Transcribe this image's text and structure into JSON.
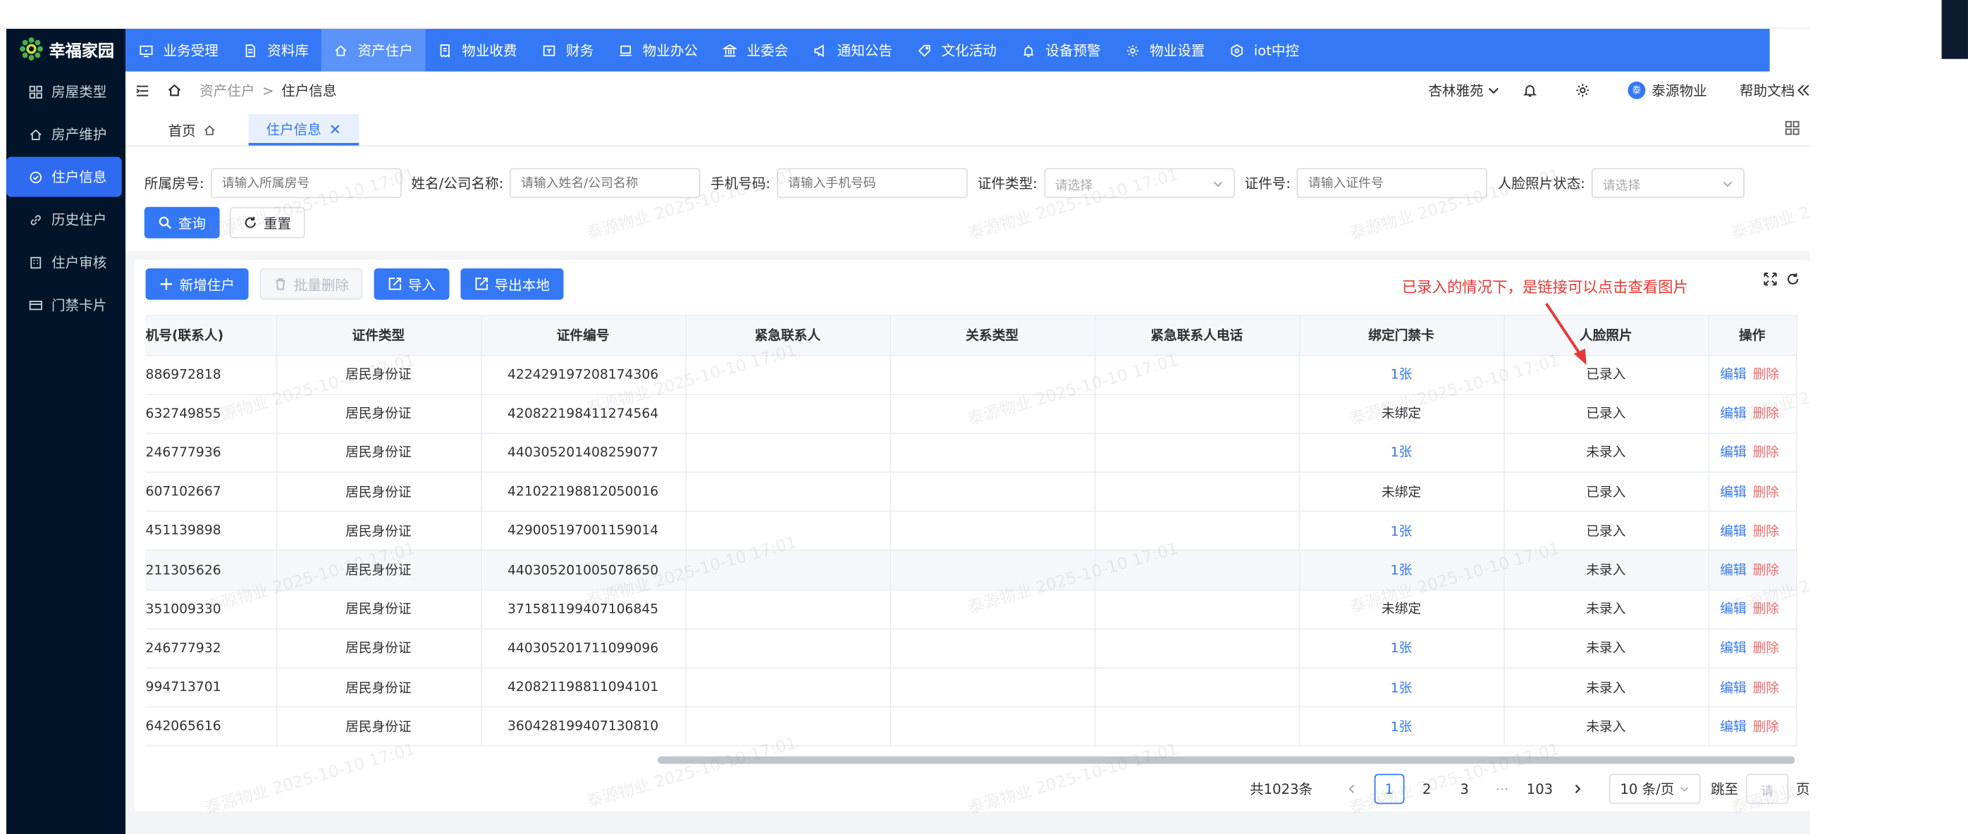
{
  "app": {
    "logo_text": "幸福家园"
  },
  "sidebar": {
    "items": [
      {
        "label": "房屋类型",
        "icon": "grid-icon"
      },
      {
        "label": "房产维护",
        "icon": "home-icon"
      },
      {
        "label": "住户信息",
        "icon": "check-circle-icon",
        "active": true
      },
      {
        "label": "历史住户",
        "icon": "link-icon"
      },
      {
        "label": "住户审核",
        "icon": "building-icon"
      },
      {
        "label": "门禁卡片",
        "icon": "card-icon"
      }
    ]
  },
  "topnav": {
    "items": [
      {
        "label": "业务受理",
        "icon": "monitor-icon"
      },
      {
        "label": "资料库",
        "icon": "document-icon"
      },
      {
        "label": "资产住户",
        "icon": "home-icon",
        "active": true
      },
      {
        "label": "物业收费",
        "icon": "receipt-icon"
      },
      {
        "label": "财务",
        "icon": "wallet-icon"
      },
      {
        "label": "物业办公",
        "icon": "laptop-icon"
      },
      {
        "label": "业委会",
        "icon": "bank-icon"
      },
      {
        "label": "通知公告",
        "icon": "megaphone-icon"
      },
      {
        "label": "文化活动",
        "icon": "tag-icon"
      },
      {
        "label": "设备预警",
        "icon": "alarm-icon"
      },
      {
        "label": "物业设置",
        "icon": "gear-icon"
      },
      {
        "label": "iot中控",
        "icon": "chip-icon"
      }
    ]
  },
  "breadcrumb": {
    "parent": "资产住户",
    "separator": ">",
    "current": "住户信息"
  },
  "header_right": {
    "community": "杏林雅苑",
    "avatar_char": "泰",
    "user": "泰源物业",
    "help": "帮助文档"
  },
  "tabs": [
    {
      "label": "首页"
    },
    {
      "label": "住户信息",
      "active": true
    }
  ],
  "filters": {
    "room": {
      "label": "所属房号:",
      "placeholder": "请输入所属房号"
    },
    "name": {
      "label": "姓名/公司名称:",
      "placeholder": "请输入姓名/公司名称"
    },
    "phone": {
      "label": "手机号码:",
      "placeholder": "请输入手机号码"
    },
    "cert_type": {
      "label": "证件类型:",
      "placeholder": "请选择"
    },
    "cert_no": {
      "label": "证件号:",
      "placeholder": "请输入证件号"
    },
    "face_status": {
      "label": "人脸照片状态:",
      "placeholder": "请选择"
    },
    "query_label": "查询",
    "reset_label": "重置"
  },
  "toolbar": {
    "add_label": "新增住户",
    "batch_delete_label": "批量删除",
    "import_label": "导入",
    "export_label": "导出本地"
  },
  "annotation": "已录入的情况下，是链接可以点击查看图片",
  "table": {
    "columns": [
      "机号(联系人)",
      "证件类型",
      "证件编号",
      "紧急联系人",
      "关系类型",
      "紧急联系人电话",
      "绑定门禁卡",
      "人脸照片",
      "操作"
    ],
    "edit_label": "编辑",
    "delete_label": "删除",
    "rows": [
      {
        "phone": "886972818",
        "cert_type": "居民身份证",
        "cert_no": "422429197208174306",
        "card": "1张",
        "face": "已录入"
      },
      {
        "phone": "632749855",
        "cert_type": "居民身份证",
        "cert_no": "420822198411274564",
        "card": "未绑定",
        "face": "已录入"
      },
      {
        "phone": "246777936",
        "cert_type": "居民身份证",
        "cert_no": "440305201408259077",
        "card": "1张",
        "face": "未录入"
      },
      {
        "phone": "607102667",
        "cert_type": "居民身份证",
        "cert_no": "421022198812050016",
        "card": "未绑定",
        "face": "已录入"
      },
      {
        "phone": "451139898",
        "cert_type": "居民身份证",
        "cert_no": "429005197001159014",
        "card": "1张",
        "face": "已录入"
      },
      {
        "phone": "211305626",
        "cert_type": "居民身份证",
        "cert_no": "440305201005078650",
        "card": "1张",
        "face": "未录入"
      },
      {
        "phone": "351009330",
        "cert_type": "居民身份证",
        "cert_no": "371581199407106845",
        "card": "未绑定",
        "face": "未录入"
      },
      {
        "phone": "246777932",
        "cert_type": "居民身份证",
        "cert_no": "440305201711099096",
        "card": "1张",
        "face": "未录入"
      },
      {
        "phone": "994713701",
        "cert_type": "居民身份证",
        "cert_no": "420821198811094101",
        "card": "1张",
        "face": "未录入"
      },
      {
        "phone": "642065616",
        "cert_type": "居民身份证",
        "cert_no": "360428199407130810",
        "card": "1张",
        "face": "未录入"
      }
    ]
  },
  "pagination": {
    "total": "共1023条",
    "pages": [
      "1",
      "2",
      "3"
    ],
    "ellipsis": "···",
    "last": "103",
    "page_size": "10 条/页",
    "jump_label": "跳至",
    "jump_placeholder": "请",
    "page_suffix": "页"
  },
  "watermark": "泰源物业 2025-10-10 17:01",
  "colors": {
    "primary": "#3478f6",
    "sidebar": "#001529",
    "danger": "#f56c6c",
    "annotation": "#e53935"
  }
}
